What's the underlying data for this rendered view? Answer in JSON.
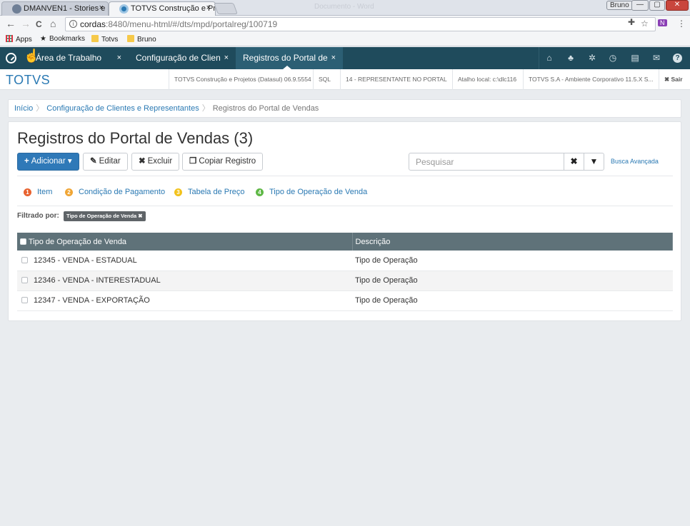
{
  "browser": {
    "tabs": [
      {
        "title": "DMANVEN1 - Stories e S",
        "close": "×"
      },
      {
        "title": "TOTVS Construção e Proj",
        "close": "×"
      }
    ],
    "faded_title": "Documento - Word",
    "user_button": "Bruno",
    "window_buttons": [
      "—",
      "▢",
      "✕"
    ],
    "nav": {
      "back": "←",
      "forward": "→",
      "reload": "C",
      "home": "⌂"
    },
    "url_host": "cordas",
    "url_rest": ":8480/menu-html/#/dts/mpd/portalreg/100719",
    "addr_icons": [
      "✚",
      "☆",
      "N",
      "⋮"
    ],
    "bookmarks": [
      "Apps",
      "Bookmarks",
      "Totvs",
      "Bruno"
    ]
  },
  "appnav": {
    "tabs": [
      {
        "label": "Área de Trabalho",
        "close": "×"
      },
      {
        "label": "Configuração de Clien",
        "close": "×"
      },
      {
        "label": "Registros do Portal de",
        "close": "×"
      }
    ],
    "icons": [
      "⌂",
      "♣",
      "✲",
      "◷",
      "▤",
      "✉",
      "?"
    ]
  },
  "status": {
    "brand": "TOTVS",
    "items": [
      "TOTVS Construção e Projetos (Datasul) 06.9.5554",
      "SQL",
      "14 - REPRESENTANTE NO PORTAL",
      "Atalho local: c:\\dlc116",
      "TOTVS S.A - Ambiente Corporativo 11.5.X S...",
      "✖ Sair"
    ]
  },
  "breadcrumb": {
    "items": [
      "Início",
      "Configuração de Clientes e Representantes"
    ],
    "current": "Registros do Portal de Vendas",
    "sep": "〉"
  },
  "page": {
    "title": "Registros do Portal de Vendas (3)",
    "buttons": {
      "add": "Adicionar",
      "add_icon": "+",
      "add_caret": "▾",
      "edit": "Editar",
      "edit_icon": "✎",
      "delete": "Excluir",
      "delete_icon": "✖",
      "copy": "Copiar Registro",
      "copy_icon": "❐"
    },
    "search": {
      "placeholder": "Pesquisar",
      "clear_icon": "✖",
      "filter_icon": "▼",
      "advanced": "Busca Avançada"
    },
    "category_tabs": [
      {
        "num": "1",
        "label": "Item",
        "color": "#e8622f"
      },
      {
        "num": "2",
        "label": "Condição de Pagamento",
        "color": "#f0a534"
      },
      {
        "num": "3",
        "label": "Tabela de Preço",
        "color": "#f2c21b"
      },
      {
        "num": "4",
        "label": "Tipo de Operação de Venda",
        "color": "#5fb846"
      }
    ],
    "filter_label": "Filtrado por:",
    "filter_chip": "Tipo de Operação de Venda ✖"
  },
  "table": {
    "columns": [
      "Tipo de Operação de Venda",
      "Descrição"
    ],
    "rows": [
      [
        "12345 - VENDA - ESTADUAL",
        "Tipo de Operação"
      ],
      [
        "12346 - VENDA - INTERESTADUAL",
        "Tipo de Operação"
      ],
      [
        "12347 - VENDA - EXPORTAÇÃO",
        "Tipo de Operação"
      ]
    ]
  }
}
